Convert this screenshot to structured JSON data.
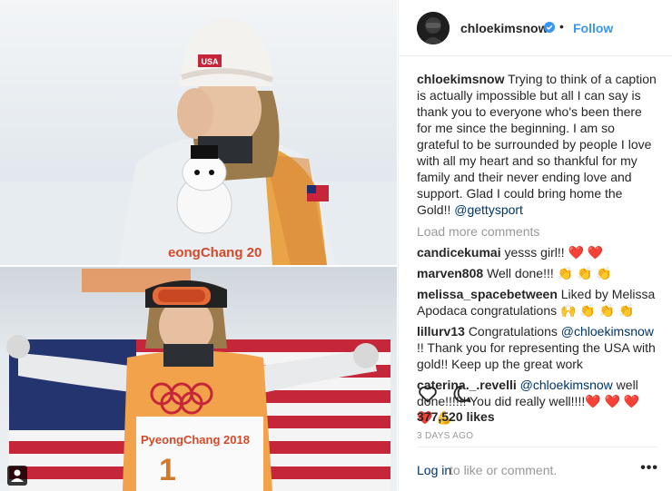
{
  "post": {
    "username": "chloekimsnow",
    "follow_label": "Follow",
    "dot": "•",
    "caption_text": "Trying to think of a caption is actually impossible but all I can say is thank you to everyone who's been there for me since the beginning. I am so grateful to be surrounded by people I love with all my heart and so thankful for my family and their never ending love and support. Glad I could bring home the Gold!!",
    "caption_mention": "@gettysport",
    "load_more": "Load more comments",
    "likes": "377,520 likes",
    "date": "3 DAYS AGO",
    "login_link": "Log in",
    "login_rest": "to like or comment.",
    "more": "•••"
  },
  "comments": [
    {
      "user": "candicekumai",
      "text": "yesss girl!!",
      "emoji": "❤️ ❤️"
    },
    {
      "user": "marven808",
      "text": "Well done!!!",
      "emoji": "👏 👏 👏"
    },
    {
      "user": "melissa_spacebetween",
      "text": "Liked by Melissa Apodaca congratulations",
      "emoji": "🙌 👏 👏 👏"
    },
    {
      "user": "lillurv13",
      "text_before": "Congratulations",
      "mention": "@chloekimsnow",
      "text_after": "!! Thank you for representing the USA with gold!! Keep up the great work"
    },
    {
      "user": "caterina._.revelli",
      "mention": "@chloekimsnow",
      "text_after": "well done!!!!!! You did really well!!!!",
      "emoji": "❤️ ❤️ ❤️ ❤️ 💪"
    }
  ],
  "photo": {
    "top_banner_text": "eongChang 20",
    "bib_text": "PyeongChang 2018",
    "bib_number": "1",
    "hat_text": "USA"
  },
  "icons": {
    "verified": "verified-badge-icon",
    "heart": "heart-icon",
    "comment": "comment-icon",
    "user_tag": "user-tag-icon"
  },
  "colors": {
    "link_blue": "#3897f0",
    "mention_navy": "#003569",
    "muted": "#999999",
    "heart_red": "#ed4956"
  }
}
